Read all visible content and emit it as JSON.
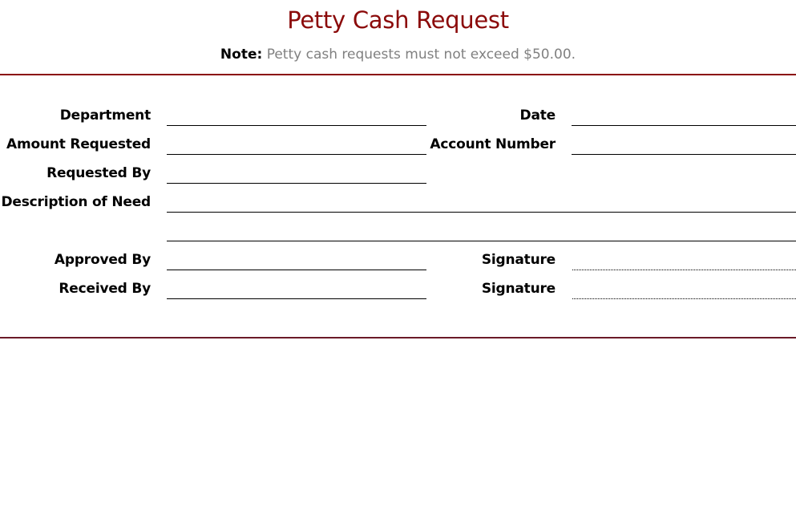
{
  "form": {
    "title": "Petty Cash Request",
    "note_label": "Note:",
    "note_text": "Petty cash requests must not exceed $50.00.",
    "fields": {
      "department": "Department",
      "date": "Date",
      "amount_requested": "Amount Requested",
      "account_number": "Account Number",
      "requested_by": "Requested By",
      "description_of_need": "Description of Need",
      "approved_by": "Approved By",
      "approved_signature": "Signature",
      "received_by": "Received By",
      "received_signature": "Signature"
    },
    "colors": {
      "title": "#8b0a0a",
      "top_rule": "#8b0a0a",
      "bottom_rule": "#6b1a28",
      "note_text": "#808080"
    }
  }
}
